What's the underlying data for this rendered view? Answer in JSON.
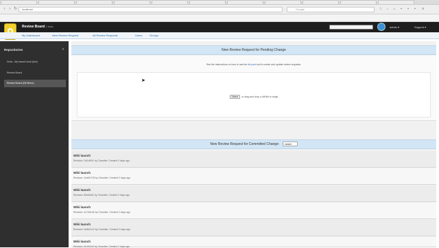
{
  "browser": {
    "tabs": [
      "",
      "",
      "",
      "",
      "",
      "",
      "",
      "",
      "",
      "",
      "",
      ""
    ],
    "url": "localhost",
    "search_placeholder": "Google",
    "bookmarks": [
      "",
      "",
      "",
      "",
      "",
      "",
      "",
      "",
      "",
      "",
      ""
    ]
  },
  "app": {
    "title": "Review Board",
    "subtitle": "0.1 beta",
    "user_menu": "admin ▾",
    "support_menu": "Support ▾"
  },
  "linkbar": {
    "links": [
      "My Dashboard",
      "New Review Request",
      "All Review Requests",
      "Users",
      "Groups"
    ]
  },
  "sidebar": {
    "title": "Repositories",
    "items": [
      {
        "label": "Drew - My branch local (test)",
        "active": false
      },
      {
        "label": "Review Board",
        "active": false
      },
      {
        "label": "Review Board (Git Mirror)",
        "active": true
      }
    ]
  },
  "pending": {
    "heading": "New Review Request for Pending Change",
    "desc_pre": "See the instructions on how to use the",
    "desc_link": "rbt post",
    "desc_post": "tool to create and update review requests.",
    "browse_label": "Select",
    "drop_text": "or drag and drop a diff file to begin"
  },
  "committed": {
    "heading": "New Review Request for Committed Change:",
    "branch": "master"
  },
  "commits": [
    {
      "title": "Wiki launch",
      "meta": "Revision: 2a2c8f31 by Chandler. Created 2 days ago"
    },
    {
      "title": "Wiki launch",
      "meta": "Revision: 1bd0b718 by Chandler. Created 2 days ago"
    },
    {
      "title": "Wiki launch",
      "meta": "Revision: 8f4e6a02 by Chandler. Created 2 days ago"
    },
    {
      "title": "Wiki launch",
      "meta": "Revision: 4c7d91e5 by Chandler. Created 2 days ago"
    },
    {
      "title": "Wiki launch",
      "meta": "Revision: 9a3b2c10 by Chandler. Created 2 days ago"
    },
    {
      "title": "Wiki launch",
      "meta": "Revision: 6e1f0d44 by Chandler. Created 2 days ago"
    }
  ],
  "colors": {
    "header_bg": "#1e1e1e",
    "sidebar_bg": "#2f2f2f",
    "section_header_bg": "#d3e6f5",
    "logo": "#f2d22e",
    "link": "#2b6cb0"
  },
  "icons": {
    "logo": "review-board-logo",
    "back": "back-icon",
    "forward": "forward-icon",
    "reload": "reload-icon",
    "search": "search-icon"
  }
}
